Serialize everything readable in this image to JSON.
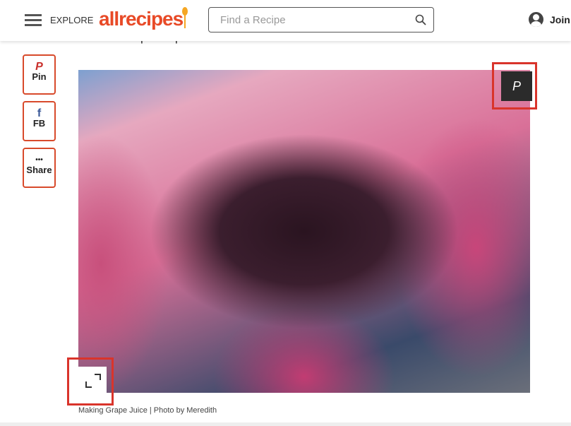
{
  "header": {
    "explore_label": "EXPLORE",
    "logo_text": "allrecipes",
    "search_placeholder": "Find a Recipe",
    "join_label": "Join"
  },
  "article": {
    "lead_text": "develop on top and sediment to fall to the bottom.",
    "share_buttons": [
      {
        "label": "Pin",
        "icon": "pinterest-icon",
        "glyph": "P"
      },
      {
        "label": "FB",
        "icon": "facebook-icon",
        "glyph": "f"
      },
      {
        "label": "Share",
        "icon": "more-dots-icon",
        "glyph": "•••"
      }
    ],
    "photo_pin_glyph": "P",
    "caption": "Making Grape Juice | Photo by Meredith"
  },
  "colors": {
    "brand": "#e84a27",
    "share_border": "#d84a2b",
    "facebook": "#3b5998",
    "highlight": "#d9342b"
  }
}
